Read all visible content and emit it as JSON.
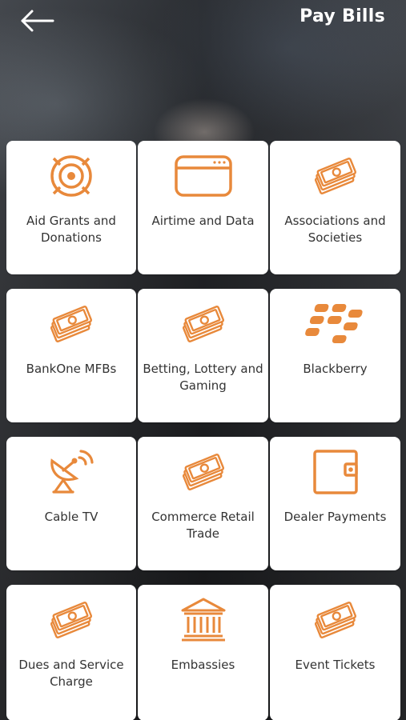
{
  "header": {
    "title": "Pay Bills",
    "back_icon": "arrow-left-icon"
  },
  "colors": {
    "accent": "#E8893B",
    "tile_background": "#FFFFFF",
    "label_text": "#333333",
    "title_text": "#FFFFFF"
  },
  "categories": [
    {
      "label": "Aid Grants and Donations",
      "icon": "target-icon"
    },
    {
      "label": "Airtime and Data",
      "icon": "browser-window-icon"
    },
    {
      "label": "Associations and Societies",
      "icon": "cash-stack-icon"
    },
    {
      "label": "BankOne MFBs",
      "icon": "cash-stack-icon"
    },
    {
      "label": "Betting, Lottery and Gaming",
      "icon": "cash-stack-icon"
    },
    {
      "label": "Blackberry",
      "icon": "blackberry-logo-icon"
    },
    {
      "label": "Cable TV",
      "icon": "satellite-dish-icon"
    },
    {
      "label": "Commerce Retail Trade",
      "icon": "cash-stack-icon"
    },
    {
      "label": "Dealer Payments",
      "icon": "wallet-icon"
    },
    {
      "label": "Dues and Service Charge",
      "icon": "cash-stack-icon"
    },
    {
      "label": "Embassies",
      "icon": "bank-building-icon"
    },
    {
      "label": "Event Tickets",
      "icon": "cash-stack-icon"
    }
  ]
}
